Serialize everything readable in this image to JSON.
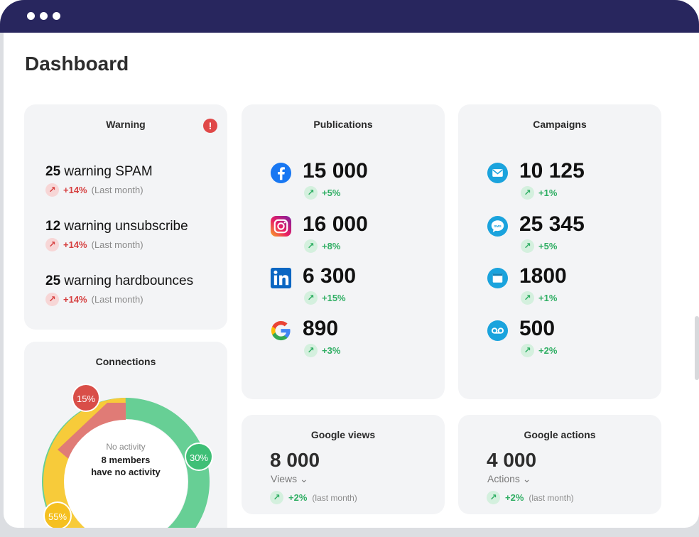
{
  "page": {
    "title": "Dashboard"
  },
  "warning": {
    "title": "Warning",
    "badge": "!",
    "items": [
      {
        "count": "25",
        "label": "warning SPAM",
        "delta": "+14%",
        "period": "(Last month)"
      },
      {
        "count": "12",
        "label": "warning unsubscribe",
        "delta": "+14%",
        "period": "(Last month)"
      },
      {
        "count": "25",
        "label": "warning hardbounces",
        "delta": "+14%",
        "period": "(Last month)"
      }
    ]
  },
  "publications": {
    "title": "Publications",
    "items": [
      {
        "icon": "facebook-icon",
        "value": "15 000",
        "delta": "+5%"
      },
      {
        "icon": "instagram-icon",
        "value": "16 000",
        "delta": "+8%"
      },
      {
        "icon": "linkedin-icon",
        "value": "6 300",
        "delta": "+15%"
      },
      {
        "icon": "google-icon",
        "value": "890",
        "delta": "+3%"
      }
    ]
  },
  "campaigns": {
    "title": "Campaigns",
    "items": [
      {
        "icon": "email-icon",
        "value": "10 125",
        "delta": "+1%"
      },
      {
        "icon": "sms-icon",
        "value": "25 345",
        "delta": "+5%",
        "icon_text": "SMS"
      },
      {
        "icon": "browser-window-icon",
        "value": "1800",
        "delta": "+1%"
      },
      {
        "icon": "voicemail-icon",
        "value": "500",
        "delta": "+2%"
      }
    ]
  },
  "connections": {
    "title": "Connections",
    "center_top": "No activity",
    "center_line1": "8 members",
    "center_line2": "have no activity",
    "segments": [
      {
        "label": "15%",
        "value": 15,
        "color": "#e07b76",
        "badge_color": "#d94e48"
      },
      {
        "label": "30%",
        "value": 30,
        "color": "#67cf95",
        "badge_color": "#3fbf76"
      },
      {
        "label": "55%",
        "value": 55,
        "color": "#f7cb3a",
        "badge_color": "#f5c020"
      }
    ]
  },
  "google_views": {
    "title": "Google views",
    "value": "8 000",
    "label": "Views",
    "delta": "+2%",
    "period": "(last month)"
  },
  "google_actions": {
    "title": "Google actions",
    "value": "4 000",
    "label": "Actions",
    "delta": "+2%",
    "period": "(last month)"
  },
  "colors": {
    "titlebar": "#28265e",
    "card_bg": "#f3f4f6",
    "up_green": "#2fae63",
    "up_red": "#d64040",
    "campaign_icon": "#1aa3dd"
  }
}
